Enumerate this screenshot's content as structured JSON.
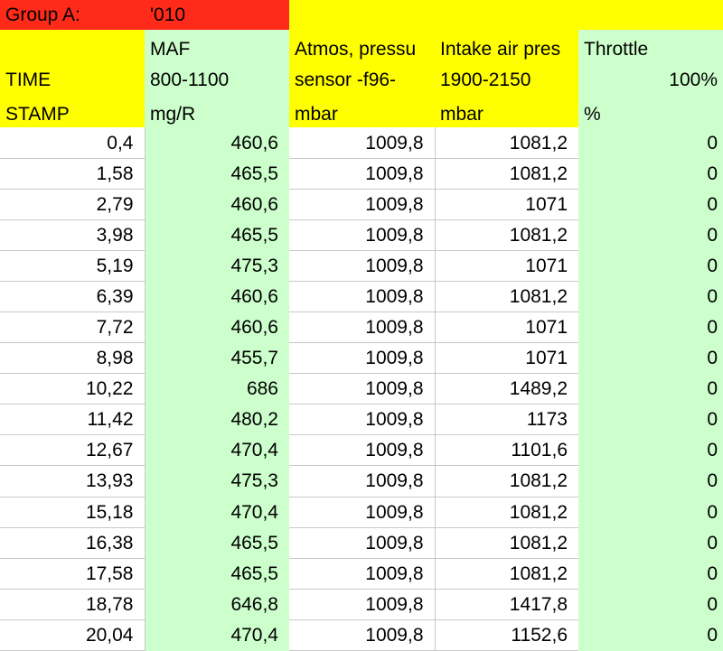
{
  "group": {
    "label": "Group A:",
    "code": "'010"
  },
  "headers": {
    "time": {
      "line1": "",
      "line2": "TIME",
      "line3": "STAMP"
    },
    "maf": {
      "line1": "MAF",
      "line2": "800-1100",
      "line3": " mg/R"
    },
    "atmos": {
      "line1": "Atmos, pressu",
      "line2": "sensor -f96-",
      "line3": " mbar"
    },
    "intake": {
      "line1": "Intake air pres",
      "line2": " 1900-2150",
      "line3": " mbar"
    },
    "throttle": {
      "line1": "Throttle",
      "line2": "100%",
      "line3": "%"
    }
  },
  "rows": [
    {
      "time": "0,4",
      "maf": "460,6",
      "atmos": "1009,8",
      "intake": "1081,2",
      "throttle": "0"
    },
    {
      "time": "1,58",
      "maf": "465,5",
      "atmos": "1009,8",
      "intake": "1081,2",
      "throttle": "0"
    },
    {
      "time": "2,79",
      "maf": "460,6",
      "atmos": "1009,8",
      "intake": "1071",
      "throttle": "0"
    },
    {
      "time": "3,98",
      "maf": "465,5",
      "atmos": "1009,8",
      "intake": "1081,2",
      "throttle": "0"
    },
    {
      "time": "5,19",
      "maf": "475,3",
      "atmos": "1009,8",
      "intake": "1071",
      "throttle": "0"
    },
    {
      "time": "6,39",
      "maf": "460,6",
      "atmos": "1009,8",
      "intake": "1081,2",
      "throttle": "0"
    },
    {
      "time": "7,72",
      "maf": "460,6",
      "atmos": "1009,8",
      "intake": "1071",
      "throttle": "0"
    },
    {
      "time": "8,98",
      "maf": "455,7",
      "atmos": "1009,8",
      "intake": "1071",
      "throttle": "0"
    },
    {
      "time": "10,22",
      "maf": "686",
      "atmos": "1009,8",
      "intake": "1489,2",
      "throttle": "0"
    },
    {
      "time": "11,42",
      "maf": "480,2",
      "atmos": "1009,8",
      "intake": "1173",
      "throttle": "0"
    },
    {
      "time": "12,67",
      "maf": "470,4",
      "atmos": "1009,8",
      "intake": "1101,6",
      "throttle": "0"
    },
    {
      "time": "13,93",
      "maf": "475,3",
      "atmos": "1009,8",
      "intake": "1081,2",
      "throttle": "0"
    },
    {
      "time": "15,18",
      "maf": "470,4",
      "atmos": "1009,8",
      "intake": "1081,2",
      "throttle": "0"
    },
    {
      "time": "16,38",
      "maf": "465,5",
      "atmos": "1009,8",
      "intake": "1081,2",
      "throttle": "0"
    },
    {
      "time": "17,58",
      "maf": "465,5",
      "atmos": "1009,8",
      "intake": "1081,2",
      "throttle": "0"
    },
    {
      "time": "18,78",
      "maf": "646,8",
      "atmos": "1009,8",
      "intake": "1417,8",
      "throttle": "0"
    },
    {
      "time": "20,04",
      "maf": "470,4",
      "atmos": "1009,8",
      "intake": "1152,6",
      "throttle": "0"
    }
  ],
  "colors": {
    "group_label_bg": "#ff2a1a",
    "header_yellow": "#ffff00",
    "header_green": "#ccffcc",
    "gridline": "#c8c8c8"
  }
}
